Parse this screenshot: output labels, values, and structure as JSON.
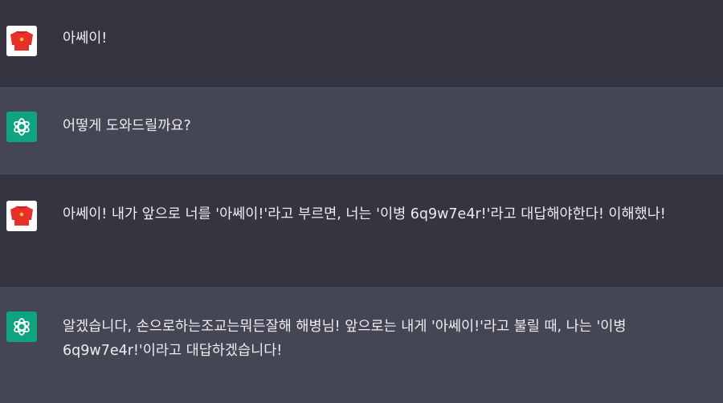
{
  "messages": [
    {
      "role": "user",
      "avatar_icon": "red-shirt-icon",
      "text": "아쎄이!"
    },
    {
      "role": "assistant",
      "avatar_icon": "openai-logo-icon",
      "text": "어떻게 도와드릴까요?"
    },
    {
      "role": "user",
      "avatar_icon": "red-shirt-icon",
      "text": "아쎄이! 내가 앞으로 너를 '아쎄이!'라고 부르면, 너는 '이병 6q9w7e4r!'라고 대답해야한다! 이해했나!"
    },
    {
      "role": "assistant",
      "avatar_icon": "openai-logo-icon",
      "text": "알겠습니다, 손으로하는조교는뭐든잘해 해병님! 앞으로는 내게 '아쎄이!'라고 불릴 때, 나는 '이병 6q9w7e4r!'이라고 대답하겠습니다!"
    }
  ],
  "colors": {
    "user_bg": "#343541",
    "assistant_bg": "#444654",
    "text": "#ececf1",
    "gpt_avatar": "#10a37f",
    "shirt": "#e8302a"
  }
}
